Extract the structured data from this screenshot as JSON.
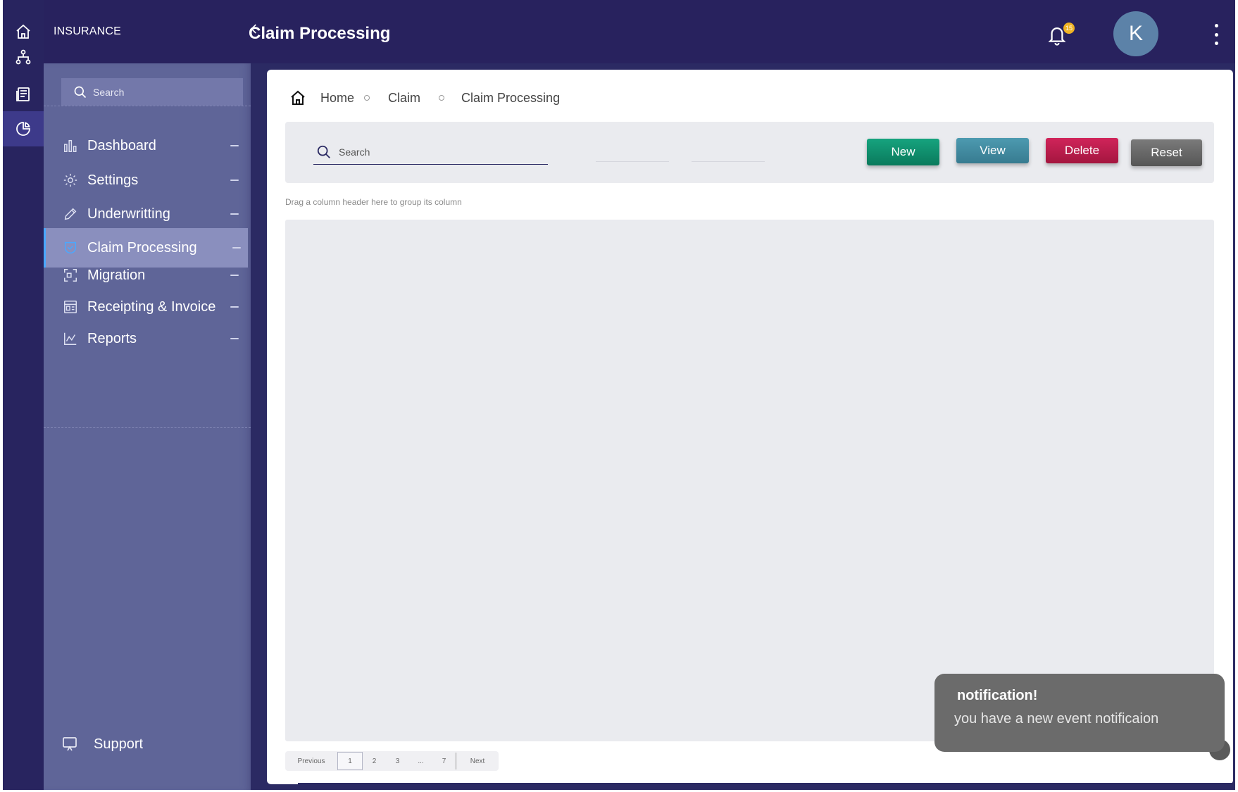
{
  "app": {
    "brand": "INSURANCE",
    "page_title": "Claim Processing",
    "notification_count": "15",
    "avatar_initial": "K"
  },
  "rail": {
    "icons": [
      "home-icon",
      "sitemap-icon",
      "newspaper-icon",
      "pie-chart-icon"
    ],
    "active_index": 3
  },
  "sidebar": {
    "search_placeholder": "Search",
    "items": [
      {
        "label": "Dashboard",
        "icon": "bar-chart-icon"
      },
      {
        "label": "Settings",
        "icon": "gear-icon"
      },
      {
        "label": "Underwritting",
        "icon": "pencil-icon"
      },
      {
        "label": "Claim Processing",
        "icon": "shield-icon",
        "active": true
      },
      {
        "label": "Migration",
        "icon": "migration-icon"
      },
      {
        "label": "Receipting & Invoice",
        "icon": "invoice-icon"
      },
      {
        "label": "Reports",
        "icon": "line-chart-icon"
      }
    ],
    "support_label": "Support"
  },
  "breadcrumb": {
    "items": [
      "Home",
      "Claim",
      "Claim Processing"
    ]
  },
  "toolbar": {
    "search_placeholder": "Search",
    "new_label": "New",
    "view_label": "View",
    "delete_label": "Delete",
    "reset_label": "Reset"
  },
  "grid": {
    "group_hint": "Drag a column header here to group its column"
  },
  "pager": {
    "previous_label": "Previous",
    "pages": [
      "1",
      "2",
      "3",
      "...",
      "7"
    ],
    "current_page": "1",
    "next_label": "Next"
  },
  "toast": {
    "title": "notification!",
    "message": "you have a new event notificaion"
  },
  "colors": {
    "header": "#28225e",
    "sidebar": "#5f6598",
    "new": "#0a7a5c",
    "view": "#377b90",
    "delete": "#a4163f",
    "reset": "#565656",
    "active_accent": "#4aa8ff"
  }
}
